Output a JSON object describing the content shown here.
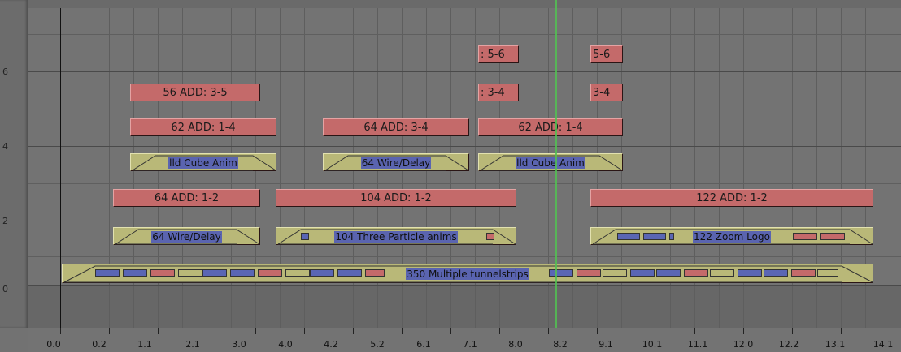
{
  "y_axis_labels": [
    "6",
    "4",
    "2",
    "0"
  ],
  "x_axis_labels": [
    "0.0",
    "0.2",
    "1.1",
    "2.1",
    "3.0",
    "4.0",
    "4.2",
    "5.2",
    "6.1",
    "7.1",
    "8.0",
    "8.2",
    "9.1",
    "10.1",
    "11.1",
    "12.0",
    "12.2",
    "13.1",
    "14.1"
  ],
  "strips": {
    "s56": "56 ADD: 3-5",
    "s62a": "62 ADD: 1-4",
    "s64add34": "64 ADD: 3-4",
    "s62b": "62 ADD: 1-4",
    "s56r": ": 5-6",
    "s56rb": "5-6",
    "s34a": ": 3-4",
    "s34b": "3-4",
    "m1": "lld Cube Anim",
    "m2": "64 Wire/Delay",
    "m3": "lld Cube Anim",
    "s64add12": "64 ADD: 1-2",
    "s104add12": "104 ADD: 1-2",
    "s122add12": "122 ADD: 1-2",
    "m4": "64 Wire/Delay",
    "m5": "104 Three Particle anims",
    "m6": "122 Zoom Logo",
    "m7": "350 Multiple tunnelstrips"
  },
  "colors": {
    "add_strip": "#c46a6a",
    "meta_strip": "#b9b878",
    "chip_blue": "#5a66b4",
    "current_frame": "#52c152"
  }
}
